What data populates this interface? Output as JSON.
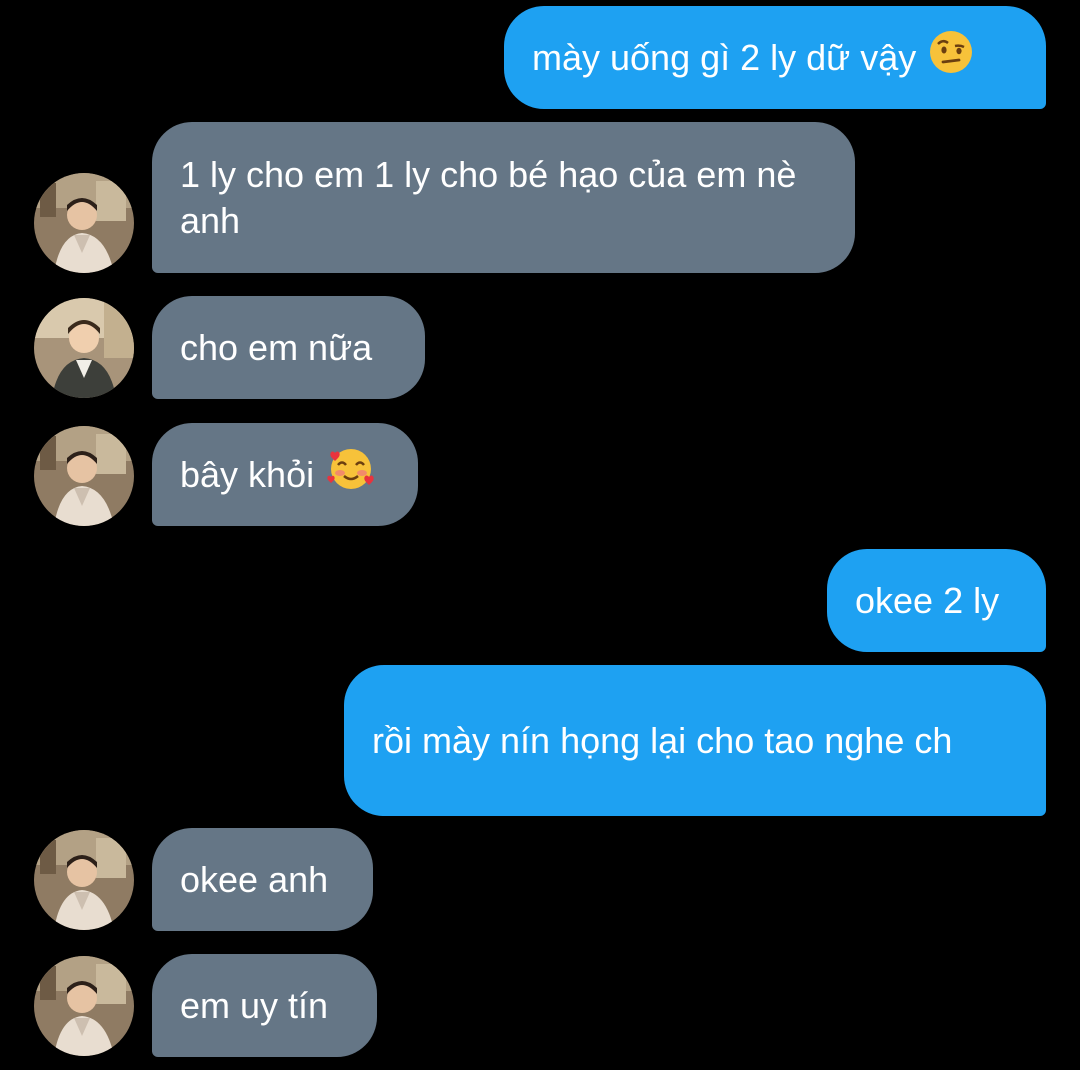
{
  "conversation": {
    "messages": [
      {
        "side": "out",
        "text": "mày uống gì 2 ly dữ vậy",
        "emoji": "raised-eyebrow-emoji"
      },
      {
        "side": "in",
        "text": "1 ly cho em 1 ly cho bé hạo của em nè anh",
        "avatar": "avatar-photo"
      },
      {
        "side": "in",
        "text": "cho em nữa",
        "avatar": "avatar-photo"
      },
      {
        "side": "in",
        "text": "bây khỏi",
        "emoji": "smiling-face-with-hearts-emoji",
        "avatar": "avatar-photo"
      },
      {
        "side": "out",
        "text": "okee 2 ly"
      },
      {
        "side": "out",
        "text": "rồi mày nín họng lại cho tao nghe ch"
      },
      {
        "side": "in",
        "text": "okee anh",
        "avatar": "avatar-photo"
      },
      {
        "side": "in",
        "text": "em uy tín",
        "avatar": "avatar-photo"
      }
    ]
  },
  "colors": {
    "background": "#000000",
    "outgoing_bubble": "#1ea1f2",
    "incoming_bubble": "#657686",
    "text": "#ffffff"
  }
}
